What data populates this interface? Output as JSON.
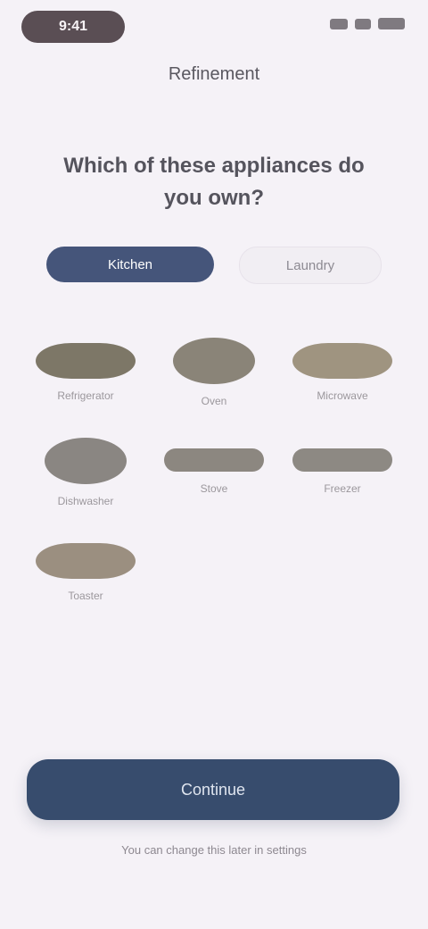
{
  "status_bar": {
    "time": "9:41"
  },
  "screen": {
    "title": "Refinement",
    "heading": "Which of these appliances do you own?"
  },
  "tabs": [
    {
      "label": "Kitchen",
      "active": true
    },
    {
      "label": "Laundry",
      "active": false
    }
  ],
  "appliances": [
    {
      "label": "Refrigerator",
      "color": "#7d7767",
      "shape": "oval"
    },
    {
      "label": "Oven",
      "color": "#8a8478",
      "shape": "round"
    },
    {
      "label": "Microwave",
      "color": "#9f9480",
      "shape": "oval"
    },
    {
      "label": "Dishwasher",
      "color": "#8a8682",
      "shape": "round"
    },
    {
      "label": "Stove",
      "color": "#8c8780",
      "shape": "wide"
    },
    {
      "label": "Freezer",
      "color": "#8d8983",
      "shape": "wide"
    },
    {
      "label": "Toaster",
      "color": "#9b8f80",
      "shape": "oval"
    }
  ],
  "footer": {
    "continue_label": "Continue",
    "note": "You can change this later in settings"
  },
  "colors": {
    "accent": "#45557a",
    "button": "#374c6d",
    "background": "#f5f2f7"
  }
}
